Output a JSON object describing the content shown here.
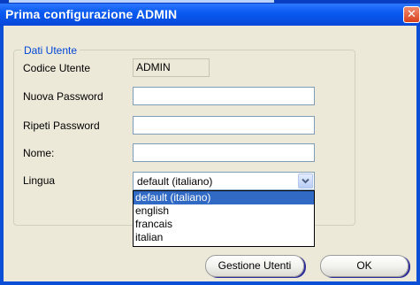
{
  "window": {
    "title": "Prima configurazione ADMIN",
    "close_glyph": "✕"
  },
  "group": {
    "legend": "Dati Utente"
  },
  "form": {
    "user_code_label": "Codice Utente",
    "user_code_value": "ADMIN",
    "new_password_label": "Nuova Password",
    "new_password_value": "",
    "repeat_password_label": "Ripeti Password",
    "repeat_password_value": "",
    "name_label": "Nome:",
    "name_value": "",
    "language_label": "Lingua",
    "language_selected": "default (italiano)",
    "language_options": [
      "default (italiano)",
      "english",
      "francais",
      "italian"
    ]
  },
  "buttons": {
    "manage_users": "Gestione Utenti",
    "ok": "OK"
  },
  "icons": {
    "close": "close-icon",
    "dropdown": "chevron-down-icon"
  },
  "colors": {
    "titlebar": "#0548d8",
    "dialog_bg": "#ece9d8",
    "legend_text": "#0046d5",
    "selection": "#316ac5",
    "close_button": "#d8411e"
  }
}
